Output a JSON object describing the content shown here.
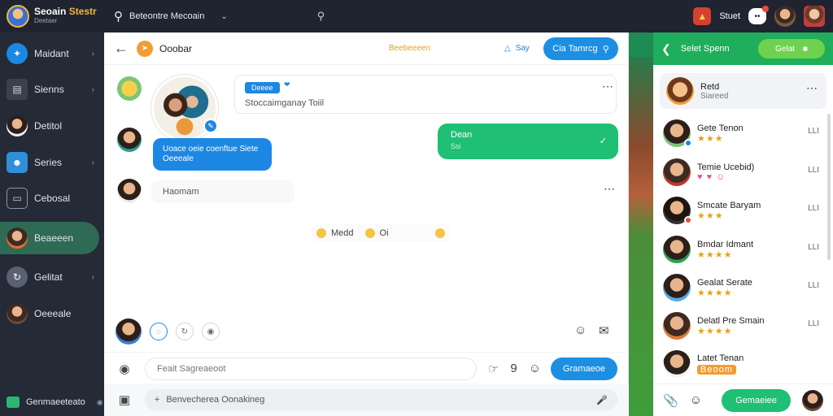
{
  "app": {
    "brand_name_a": "Seoain ",
    "brand_name_b": "Stestr",
    "brand_sub": "Deetaer"
  },
  "topbar": {
    "search_label": "Beteontre Mecoain",
    "user_text": "Stuet"
  },
  "sidebar": {
    "items": [
      {
        "label": "Maidant",
        "icon": "sparkle-icon",
        "color": "#1d87e4"
      },
      {
        "label": "Sienns",
        "icon": "trash-icon",
        "color": "#3a404d"
      },
      {
        "label": "Detitol",
        "icon": "avatar",
        "color": "#3a404d"
      },
      {
        "label": "Series",
        "icon": "person-icon",
        "color": "#3a404d"
      },
      {
        "label": "Cebosal",
        "icon": "folder-icon",
        "color": "#3a404d"
      },
      {
        "label": "Beaeeen",
        "icon": "avatar",
        "color": "#e86e2c"
      },
      {
        "label": "Gelitat",
        "icon": "refresh-icon",
        "color": "#3a404d"
      },
      {
        "label": "Oeeeale",
        "icon": "avatar",
        "color": "#3a404d"
      }
    ],
    "bottom_label": "Genmaeeteato"
  },
  "chat": {
    "title": "Ooobar",
    "center_text": "Beebeeeen",
    "say_label": "Say",
    "header_button": "Cia Tamrcg",
    "card_tag": "Deeee",
    "card_text": "Stoccaimganay Toiil",
    "blue_bubble": "Uoace oeie coenftue Siete Oeeeale",
    "green_bubble_title": "Dean",
    "green_bubble_sub": "Ssi",
    "plain_message": "Haomam",
    "emoji_text": "Medd",
    "emoji_text_2": "Oi",
    "composer_placeholder": "Feait Sagreaeoot",
    "thumbs_count": "9",
    "send_label": "Gramaeoe",
    "strip_placeholder": "Benvecherea Oonakineg"
  },
  "right_panel": {
    "header_title": "Selet Spenn",
    "header_button": "Gelat",
    "top_card": {
      "name": "Retd",
      "sub": "Siareed"
    },
    "contacts": [
      {
        "name": "Gete Tenon",
        "meta": "★★★",
        "dot": "#1d87e4"
      },
      {
        "name": "Temie Ucebid)",
        "meta": "♥ ♥ ☺",
        "dot": ""
      },
      {
        "name": "Smcate Baryam",
        "meta": "★★★",
        "dot": "#e84b3c"
      },
      {
        "name": "Bmdar Idmant",
        "meta": "★★★★",
        "dot": ""
      },
      {
        "name": "Gealat Serate",
        "meta": "★★★★",
        "dot": ""
      },
      {
        "name": "Delatl Pre Smain",
        "meta": "★★★★",
        "dot": ""
      },
      {
        "name": "Latet Tenan",
        "meta": "Beoom",
        "dot": ""
      }
    ],
    "contact_side_label": "LLI",
    "footer_button": "Gemaeiee"
  }
}
